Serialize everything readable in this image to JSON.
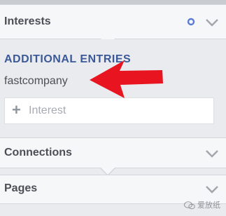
{
  "sections": {
    "interests": {
      "title": "Interests"
    },
    "connections": {
      "title": "Connections"
    },
    "pages": {
      "title": "Pages"
    }
  },
  "additional": {
    "label": "ADDITIONAL ENTRIES",
    "entry": "fastcompany"
  },
  "input": {
    "placeholder": "Interest",
    "plus": "+"
  },
  "colors": {
    "arrow": "#e8141f",
    "heading_blue": "#3b5998",
    "chevron": "#a2a6ad",
    "dot": "#5b7bd5"
  },
  "watermark": {
    "text": "爱放纸"
  },
  "icons": [
    "settings-dot-icon",
    "chevron-down-icon",
    "plus-icon",
    "red-arrow-annotation",
    "wechat-watermark-icon"
  ]
}
